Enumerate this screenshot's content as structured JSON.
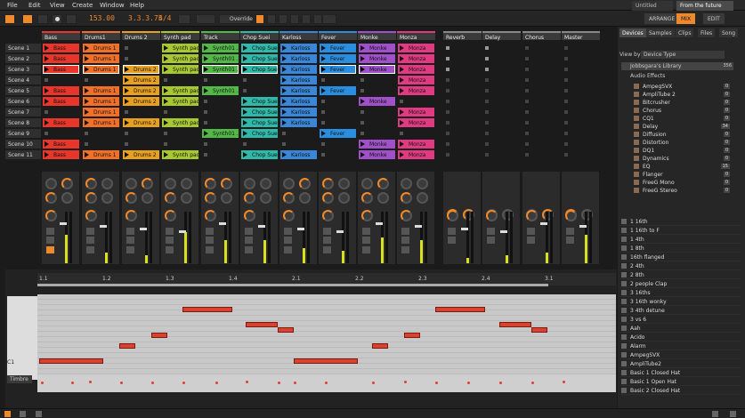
{
  "menu": [
    "File",
    "Edit",
    "View",
    "Create",
    "Window",
    "Help"
  ],
  "doc_tabs": [
    "Untitled",
    "From the future"
  ],
  "transport": {
    "tempo": "153.00",
    "position": "3.3.3.75",
    "signature": "4/4",
    "override": "Override"
  },
  "modes": [
    "ARRANGE",
    "MIX",
    "EDIT"
  ],
  "tracks": [
    {
      "name": "Bass",
      "color": "#e8362a"
    },
    {
      "name": "Drums1",
      "color": "#f0702a"
    },
    {
      "name": "Drums 2",
      "color": "#e8a020"
    },
    {
      "name": "Synth pad",
      "color": "#a8c832"
    },
    {
      "name": "Track",
      "color": "#54b848"
    },
    {
      "name": "Chop Suei",
      "color": "#30b8a8"
    },
    {
      "name": "Karloss",
      "color": "#3a86d8"
    },
    {
      "name": "Fever",
      "color": "#2a8ee0"
    },
    {
      "name": "Monke",
      "color": "#a050c8"
    },
    {
      "name": "Monza",
      "color": "#e03a82"
    }
  ],
  "effects": [
    "Reverb",
    "Delay",
    "Chorus",
    "Master"
  ],
  "scenes": [
    "Scene 1",
    "Scene 2",
    "Scene 3",
    "Scene 4",
    "Scene 5",
    "Scene 6",
    "Scene 7",
    "Scene 8",
    "Scene 9",
    "Scene 10",
    "Scene 11"
  ],
  "clips": [
    [
      "Bass",
      "Drums 1",
      "",
      "Synth pad",
      "Synth01 ...",
      "Chop Suei",
      "Karloss",
      "Fever",
      "Monke",
      "Monza"
    ],
    [
      "Bass",
      "Drums 1",
      "",
      "Synth pad",
      "Synth01 ...",
      "Chop Suei",
      "Karloss",
      "Fever",
      "Monke",
      "Monza"
    ],
    [
      "Bass",
      "Drums 1",
      "Drums 2",
      "Synth pad",
      "Synth01 ...",
      "Chop Suei",
      "Karloss",
      "Fever",
      "Monke",
      "Monza"
    ],
    [
      "",
      "",
      "Drums 2",
      "",
      "",
      "",
      "Karloss",
      "",
      "",
      "Monza"
    ],
    [
      "Bass",
      "Drums 1",
      "Drums 2",
      "Synth pad",
      "Synth01 ...",
      "",
      "Karloss",
      "Fever",
      "",
      "Monza"
    ],
    [
      "Bass",
      "Drums 1",
      "Drums 2",
      "Synth pad",
      "",
      "Chop Suei",
      "Karloss",
      "",
      "Monke",
      ""
    ],
    [
      "",
      "Drums 1",
      "",
      "",
      "",
      "Chop Suei",
      "Karloss",
      "",
      "",
      "Monza"
    ],
    [
      "Bass",
      "Drums 1",
      "Drums 2",
      "Synth pad",
      "",
      "Chop Suei",
      "Karloss",
      "",
      "",
      "Monza"
    ],
    [
      "",
      "",
      "",
      "",
      "Synth01 ...",
      "Chop Suei",
      "",
      "Fever",
      "",
      ""
    ],
    [
      "Bass",
      "",
      "",
      "",
      "",
      "",
      "",
      "",
      "Monke",
      "Monza"
    ],
    [
      "Bass",
      "Drums 1",
      "Drums 2",
      "Synth pad",
      "",
      "Chop Suei",
      "Karloss",
      "",
      "Monke",
      "Monza"
    ]
  ],
  "playing": [
    [
      2,
      0
    ],
    [
      2,
      1
    ],
    [
      2,
      2
    ],
    [
      2,
      4
    ],
    [
      2,
      5
    ],
    [
      2,
      7
    ],
    [
      2,
      8
    ]
  ],
  "ruler": [
    "1.1",
    "1.2",
    "1.3",
    "1.4",
    "2.1",
    "2.2",
    "2.3",
    "2.4",
    "3.1"
  ],
  "piano_label": "C1",
  "timbre": "Timbre",
  "side": {
    "tabs": [
      "Devices",
      "Samples",
      "Clips",
      "Files",
      "Song"
    ],
    "view_by": "View by",
    "view_by_value": "Device Type",
    "library": "Jobbsgara's Library",
    "library_count": "356",
    "section": "Audio Effects",
    "devices": [
      [
        "AmpegSVX",
        "0"
      ],
      [
        "AmpliTube 2",
        "0"
      ],
      [
        "Bitcrusher",
        "0"
      ],
      [
        "Chorus",
        "0"
      ],
      [
        "CQ1",
        "0"
      ],
      [
        "Delay",
        "34"
      ],
      [
        "Diffusion",
        "0"
      ],
      [
        "Distortion",
        "0"
      ],
      [
        "DQ1",
        "0"
      ],
      [
        "Dynamics",
        "0"
      ],
      [
        "EQ",
        "15"
      ],
      [
        "Flanger",
        "0"
      ],
      [
        "FreeG Mono",
        "0"
      ],
      [
        "FreeG Stereo",
        "0"
      ]
    ],
    "presets": [
      "1 16th",
      "1 16th to F",
      "1 4th",
      "1 8th",
      "16th flanged",
      "2 4th",
      "2 8th",
      "2 people Clap",
      "3 16ths",
      "3 16th wonky",
      "3 4th detune",
      "3 vs 6",
      "Aah",
      "Acido",
      "Alarm",
      "AmpegSVX",
      "AmpliTube2",
      "Basic 1 Closed Hat",
      "Basic 1 Open Hat",
      "Basic 2 Closed Hat"
    ]
  }
}
